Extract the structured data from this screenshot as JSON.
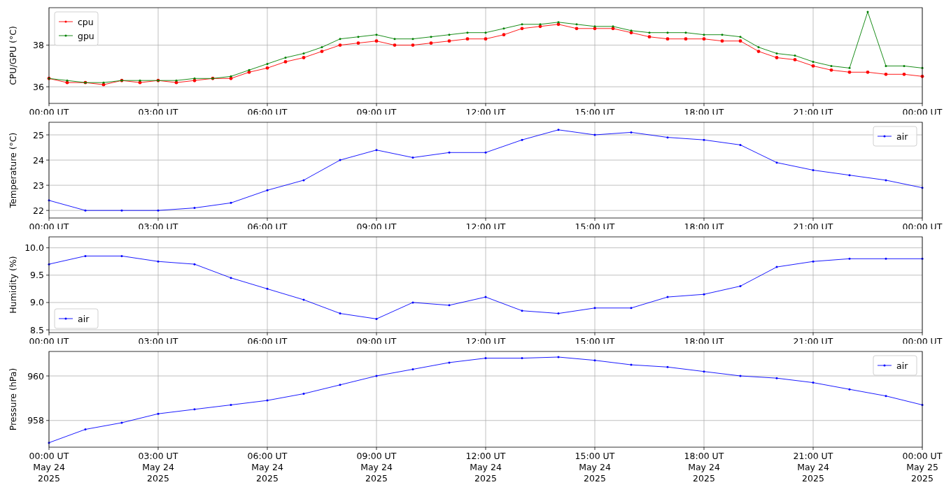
{
  "panels": [
    {
      "chart_data": {
        "type": "line",
        "legend": "upper left",
        "grid": true,
        "ylabel": "CPU/GPU (°C)",
        "ylim": [
          35.2,
          39.8
        ],
        "yticks": [
          36,
          38
        ],
        "categories": [
          "00:00 UT",
          null,
          null,
          null,
          null,
          null,
          "03:00 UT",
          null,
          null,
          null,
          null,
          null,
          "06:00 UT",
          null,
          null,
          null,
          null,
          null,
          "09:00 UT",
          null,
          null,
          null,
          null,
          null,
          "12:00 UT",
          null,
          null,
          null,
          null,
          null,
          "15:00 UT",
          null,
          null,
          null,
          null,
          null,
          "18:00 UT",
          null,
          null,
          null,
          null,
          null,
          "21:00 UT",
          null,
          null,
          null,
          null,
          null,
          "00:00 UT"
        ],
        "series": [
          {
            "name": "cpu",
            "color": "#ff0000",
            "values": [
              36.4,
              36.2,
              36.2,
              36.1,
              36.3,
              36.2,
              36.3,
              36.2,
              36.3,
              36.4,
              36.4,
              36.7,
              36.9,
              37.2,
              37.4,
              37.7,
              38.0,
              38.1,
              38.2,
              38.0,
              38.0,
              38.1,
              38.2,
              38.3,
              38.3,
              38.5,
              38.8,
              38.9,
              39.0,
              38.8,
              38.8,
              38.8,
              38.6,
              38.4,
              38.3,
              38.3,
              38.3,
              38.2,
              38.2,
              37.7,
              37.4,
              37.3,
              37.0,
              36.8,
              36.7,
              36.7,
              36.6,
              36.6,
              36.5
            ]
          },
          {
            "name": "gpu",
            "color": "#008000",
            "values": [
              36.4,
              36.3,
              36.2,
              36.2,
              36.3,
              36.3,
              36.3,
              36.3,
              36.4,
              36.4,
              36.5,
              36.8,
              37.1,
              37.4,
              37.6,
              37.9,
              38.3,
              38.4,
              38.5,
              38.3,
              38.3,
              38.4,
              38.5,
              38.6,
              38.6,
              38.8,
              39.0,
              39.0,
              39.1,
              39.0,
              38.9,
              38.9,
              38.7,
              38.6,
              38.6,
              38.6,
              38.5,
              38.5,
              38.4,
              37.9,
              37.6,
              37.5,
              37.2,
              37.0,
              36.9,
              39.6,
              37.0,
              37.0,
              36.9
            ]
          }
        ]
      }
    },
    {
      "chart_data": {
        "type": "line",
        "legend": "upper right",
        "grid": true,
        "ylabel": "Temperature (°C)",
        "ylim": [
          21.7,
          25.5
        ],
        "yticks": [
          22,
          23,
          24,
          25
        ],
        "categories": [
          "00:00 UT",
          null,
          null,
          "03:00 UT",
          null,
          null,
          "06:00 UT",
          null,
          null,
          "09:00 UT",
          null,
          null,
          "12:00 UT",
          null,
          null,
          "15:00 UT",
          null,
          null,
          "18:00 UT",
          null,
          null,
          "21:00 UT",
          null,
          null,
          "00:00 UT"
        ],
        "series": [
          {
            "name": "air",
            "color": "#0000ff",
            "values": [
              22.4,
              22.0,
              22.0,
              22.0,
              22.1,
              22.3,
              22.8,
              23.2,
              24.0,
              24.4,
              24.1,
              24.3,
              24.3,
              24.8,
              25.2,
              25.0,
              25.1,
              24.9,
              24.8,
              24.6,
              23.9,
              23.6,
              23.4,
              23.2,
              22.9
            ]
          }
        ]
      }
    },
    {
      "chart_data": {
        "type": "line",
        "legend": "lower left",
        "grid": true,
        "ylabel": "Humidity (%)",
        "ylim": [
          8.45,
          10.2
        ],
        "yticks": [
          {
            "value": 8.5,
            "label": "8.5"
          },
          {
            "value": 9,
            "label": "9.0"
          },
          {
            "value": 9.5,
            "label": "9.5"
          },
          {
            "value": 10,
            "label": "10.0"
          }
        ],
        "categories": [
          "00:00 UT",
          null,
          null,
          "03:00 UT",
          null,
          null,
          "06:00 UT",
          null,
          null,
          "09:00 UT",
          null,
          null,
          "12:00 UT",
          null,
          null,
          "15:00 UT",
          null,
          null,
          "18:00 UT",
          null,
          null,
          "21:00 UT",
          null,
          null,
          "00:00 UT"
        ],
        "series": [
          {
            "name": "air",
            "color": "#0000ff",
            "values": [
              9.7,
              9.85,
              9.85,
              9.75,
              9.7,
              9.45,
              9.25,
              9.05,
              8.8,
              8.7,
              9.0,
              8.95,
              9.1,
              8.85,
              8.8,
              8.9,
              8.9,
              9.1,
              9.15,
              9.3,
              9.65,
              9.75,
              9.8,
              9.8,
              9.8
            ]
          }
        ]
      }
    },
    {
      "chart_data": {
        "type": "line",
        "legend": "upper right",
        "grid": true,
        "ylabel": "Pressure (hPa)",
        "ylim": [
          956.8,
          961.1
        ],
        "yticks": [
          958,
          960
        ],
        "categories": [
          "00:00 UT\nMay 24\n2025",
          null,
          null,
          "03:00 UT\nMay 24\n2025",
          null,
          null,
          "06:00 UT\nMay 24\n2025",
          null,
          null,
          "09:00 UT\nMay 24\n2025",
          null,
          null,
          "12:00 UT\nMay 24\n2025",
          null,
          null,
          "15:00 UT\nMay 24\n2025",
          null,
          null,
          "18:00 UT\nMay 24\n2025",
          null,
          null,
          "21:00 UT\nMay 24\n2025",
          null,
          null,
          "00:00 UT\nMay 25\n2025"
        ],
        "series": [
          {
            "name": "air",
            "color": "#0000ff",
            "values": [
              957.0,
              957.6,
              957.9,
              958.3,
              958.5,
              958.7,
              958.9,
              959.2,
              959.6,
              960.0,
              960.3,
              960.6,
              960.8,
              960.8,
              960.85,
              960.7,
              960.5,
              960.4,
              960.2,
              960.0,
              959.9,
              959.7,
              959.4,
              959.1,
              958.7
            ]
          }
        ]
      }
    }
  ]
}
